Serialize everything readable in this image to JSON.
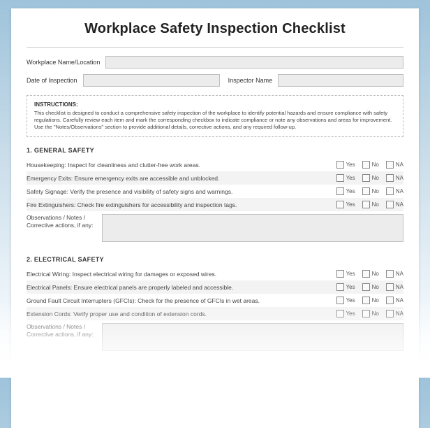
{
  "title": "Workplace Safety Inspection Checklist",
  "fields": {
    "workplace_label": "Workplace Name/Location",
    "date_label": "Date of Inspection",
    "inspector_label": "Inspector Name"
  },
  "instructions": {
    "heading": "INSTRUCTIONS:",
    "body": "This checklist is designed to conduct a comprehensive safety inspection of the workplace to identify potential hazards and ensure compliance with safety regulations. Carefully review each item and mark the corresponding checkbox to indicate compliance or note any observations and areas for improvement. Use the \"Notes/Observations\" section to provide additional details, corrective actions, and any required follow-up."
  },
  "check_labels": {
    "yes": "Yes",
    "no": "No",
    "na": "NA"
  },
  "sections": [
    {
      "title": "1. GENERAL SAFETY",
      "items": [
        "Housekeeping: Inspect for cleanliness and clutter-free work areas.",
        "Emergency Exits: Ensure emergency exits are accessible and unblocked.",
        "Safety Signage: Verify the presence and visibility of safety signs and warnings.",
        "Fire Extinguishers: Check fire extinguishers for accessibility and inspection tags."
      ],
      "notes_label": "Observations / Notes / Corrective actions, if any:"
    },
    {
      "title": "2. ELECTRICAL SAFETY",
      "items": [
        "Electrical Wiring: Inspect electrical wiring for damages or exposed wires.",
        "Electrical Panels: Ensure electrical panels are properly labeled and accessible.",
        "Ground Fault Circuit Interrupters (GFCIs): Check for the presence of GFCIs in wet areas.",
        "Extension Cords: Verify proper use and condition of extension cords."
      ],
      "notes_label": "Observations / Notes / Corrective actions, if any:"
    }
  ]
}
